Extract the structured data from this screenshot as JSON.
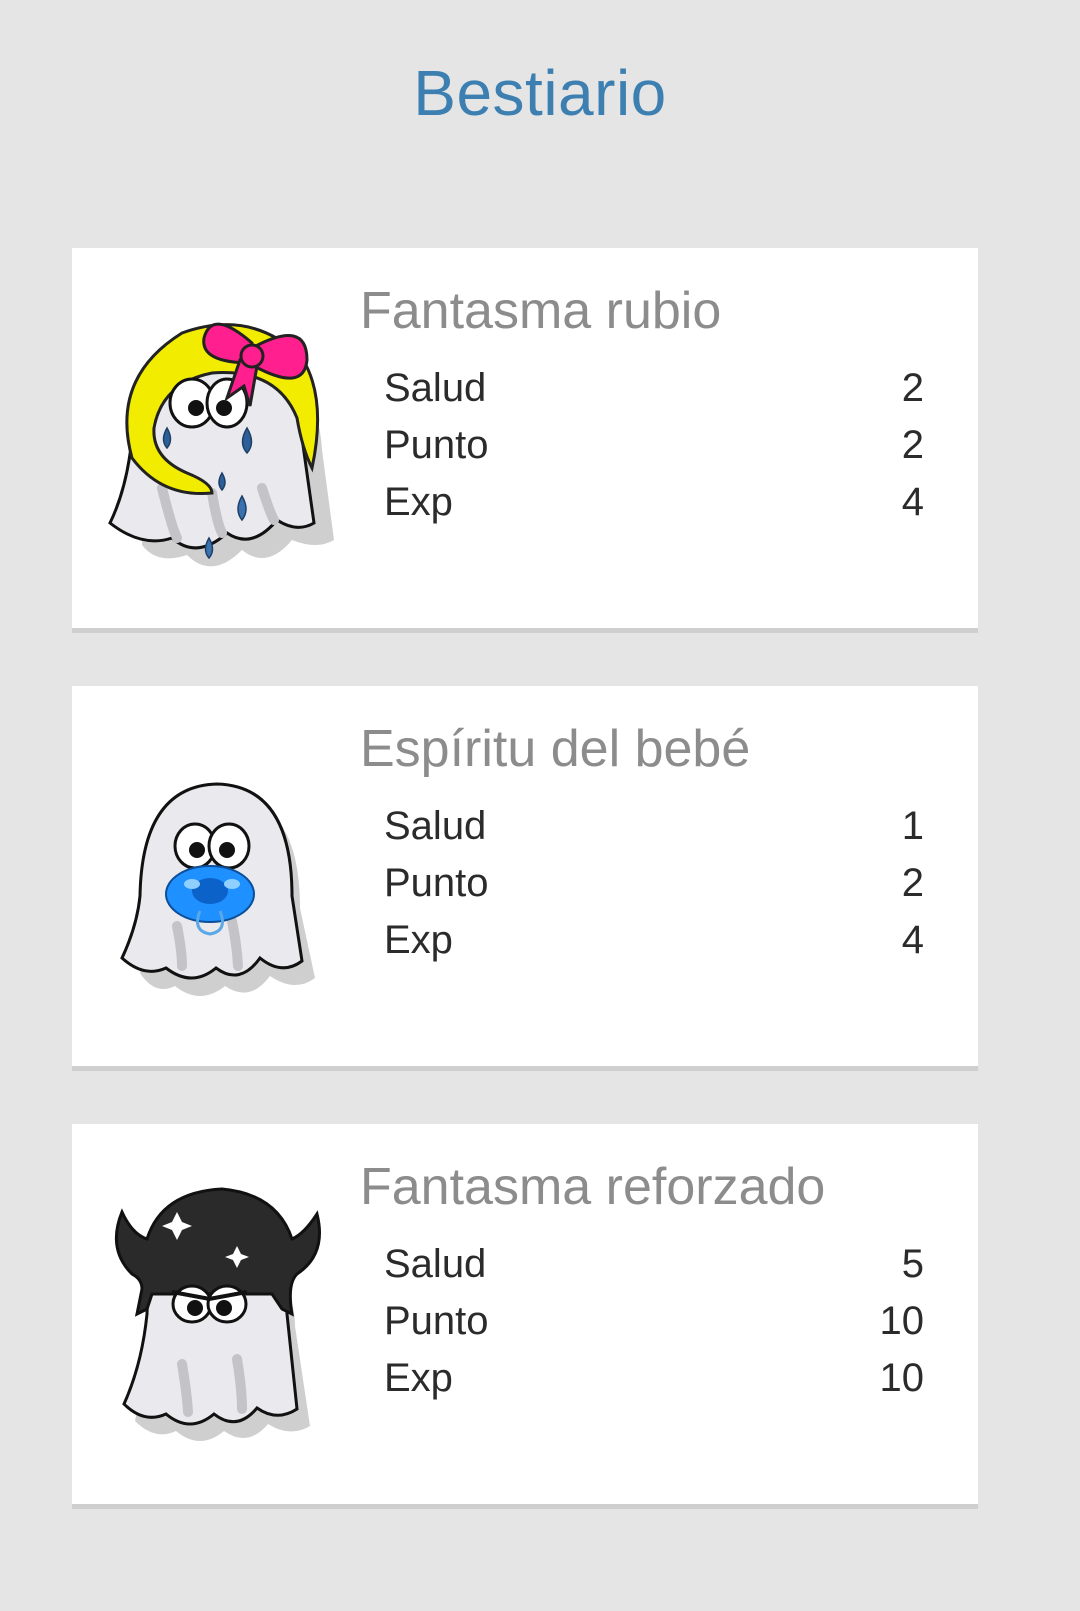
{
  "page": {
    "title": "Bestiario"
  },
  "monsters": [
    {
      "name": "Fantasma rubio",
      "icon": "blonde-ghost-icon",
      "stats": [
        {
          "label": "Salud",
          "value": "2"
        },
        {
          "label": "Punto",
          "value": "2"
        },
        {
          "label": "Exp",
          "value": "4"
        }
      ]
    },
    {
      "name": "Espíritu del bebé",
      "icon": "baby-ghost-icon",
      "stats": [
        {
          "label": "Salud",
          "value": "1"
        },
        {
          "label": "Punto",
          "value": "2"
        },
        {
          "label": "Exp",
          "value": "4"
        }
      ]
    },
    {
      "name": "Fantasma reforzado",
      "icon": "reinforced-ghost-icon",
      "stats": [
        {
          "label": "Salud",
          "value": "5"
        },
        {
          "label": "Punto",
          "value": "10"
        },
        {
          "label": "Exp",
          "value": "10"
        }
      ]
    }
  ],
  "colors": {
    "background": "#e5e5e5",
    "title": "#3c7fb0",
    "card": "#ffffff",
    "name": "#8c8c8c",
    "stat_text": "#2b2b2b",
    "hair_yellow": "#f2ec00",
    "bow_pink": "#ff1f8e",
    "pacifier_blue": "#1e90ff",
    "helmet_black": "#2a2a2a"
  }
}
